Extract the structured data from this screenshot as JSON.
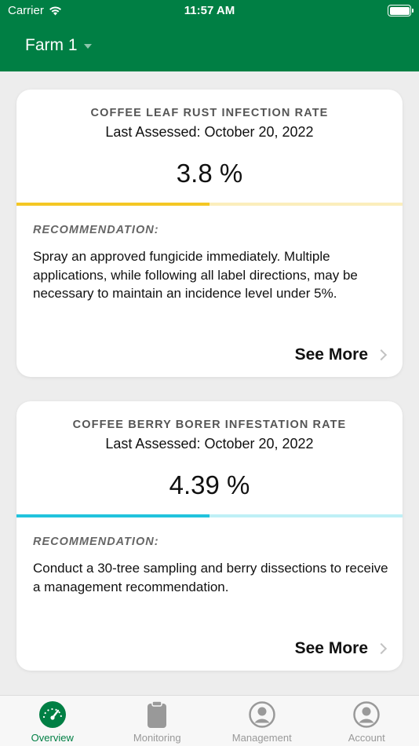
{
  "status_bar": {
    "carrier": "Carrier",
    "time": "11:57 AM"
  },
  "header": {
    "farm_name": "Farm 1"
  },
  "cards": [
    {
      "title": "COFFEE LEAF RUST INFECTION RATE",
      "last_assessed": "Last Assessed: October 20, 2022",
      "value": "3.8 %",
      "progress_fraction": 0.5,
      "recommendation_label": "RECOMMENDATION:",
      "recommendation_text": "Spray an approved fungicide immediately. Multiple applications, while following all label directions, may be necessary to maintain an incidence level under 5%.",
      "see_more": "See More"
    },
    {
      "title": "COFFEE BERRY BORER INFESTATION RATE",
      "last_assessed": "Last Assessed: October 20, 2022",
      "value": "4.39 %",
      "progress_fraction": 0.5,
      "recommendation_label": "RECOMMENDATION:",
      "recommendation_text": "Conduct a 30-tree sampling and berry dissections to receive a management recommendation.",
      "see_more": "See More"
    }
  ],
  "tabs": [
    {
      "label": "Overview",
      "icon": "speedometer-icon",
      "active": true
    },
    {
      "label": "Monitoring",
      "icon": "clipboard-icon",
      "active": false
    },
    {
      "label": "Management",
      "icon": "person-circle-icon",
      "active": false
    },
    {
      "label": "Account",
      "icon": "person-circle-icon",
      "active": false
    }
  ],
  "colors": {
    "brand_green": "#007f44",
    "rust_bar": "#f4c724",
    "borer_bar": "#22c3dd",
    "inactive_tab": "#999999"
  }
}
